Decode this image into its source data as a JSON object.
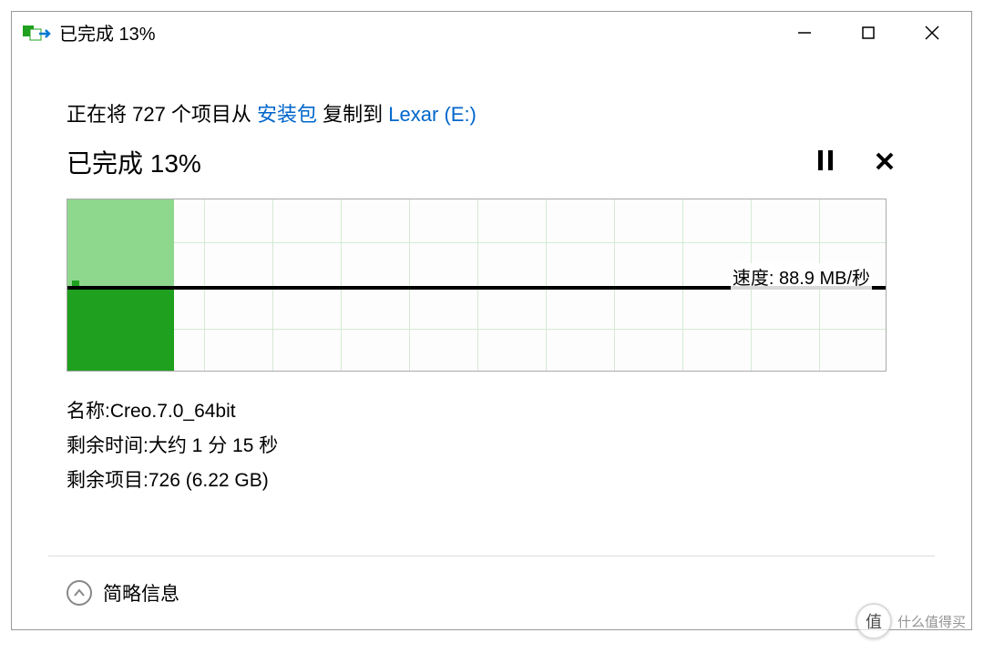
{
  "window": {
    "title": "已完成 13%"
  },
  "copy": {
    "prefix": "正在将 727 个项目从 ",
    "source": "安装包",
    "middle": " 复制到 ",
    "dest": "Lexar (E:)"
  },
  "progress": {
    "label": "已完成 13%"
  },
  "chart_data": {
    "type": "area",
    "progress_percent": 13,
    "speed_label": "速度: 88.9 MB/秒",
    "speed_value_mb_per_s": 88.9,
    "grid": {
      "columns": 12,
      "rows": 4
    }
  },
  "details": {
    "name_label": "名称: ",
    "name_value": "Creo.7.0_64bit",
    "time_label": "剩余时间: ",
    "time_value": "大约 1 分 15 秒",
    "items_label": "剩余项目: ",
    "items_value": "726 (6.22 GB)"
  },
  "footer": {
    "toggle": "简略信息"
  },
  "watermark": {
    "badge": "值",
    "text": "什么值得买"
  }
}
